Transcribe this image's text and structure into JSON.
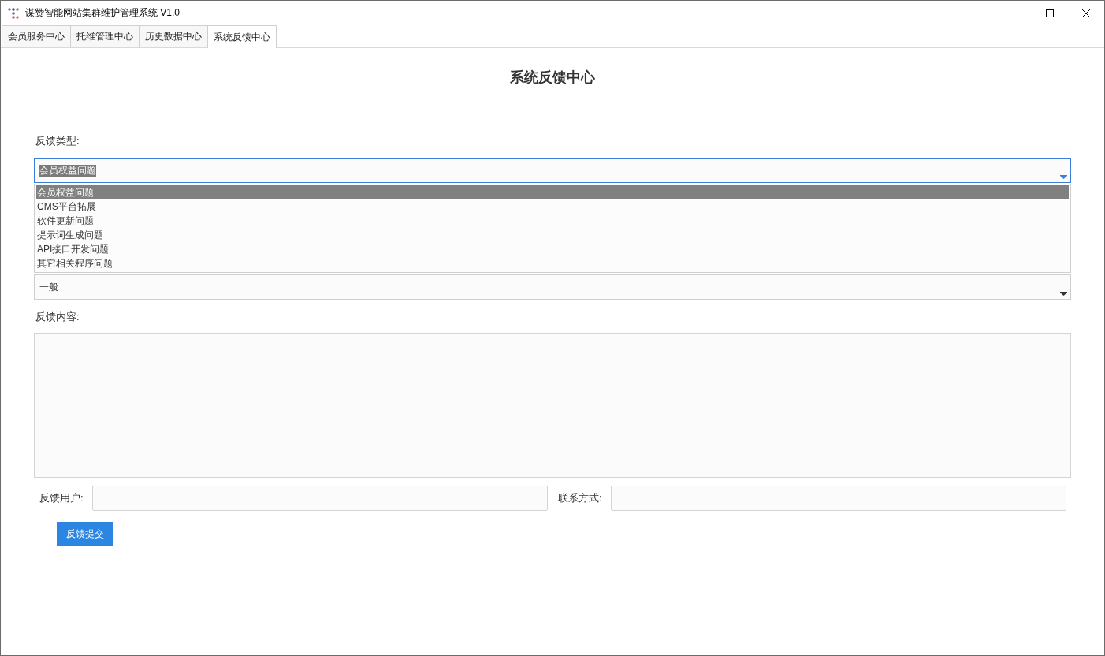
{
  "window": {
    "title": "谋赞智能网站集群维护管理系统 V1.0"
  },
  "tabs": [
    {
      "label": "会员服务中心",
      "selected": false
    },
    {
      "label": "托维管理中心",
      "selected": false
    },
    {
      "label": "历史数据中心",
      "selected": false
    },
    {
      "label": "系统反馈中心",
      "selected": true
    }
  ],
  "page_title": "系统反馈中心",
  "feedback_type": {
    "label": "反馈类型:",
    "value": "会员权益问题",
    "focused": true,
    "expanded": true,
    "options": [
      {
        "label": "会员权益问题",
        "selected": true
      },
      {
        "label": "CMS平台拓展",
        "selected": false
      },
      {
        "label": "软件更新问题",
        "selected": false
      },
      {
        "label": "提示词生成问题",
        "selected": false
      },
      {
        "label": "API接口开发问题",
        "selected": false
      },
      {
        "label": "其它相关程序问题",
        "selected": false
      }
    ]
  },
  "priority": {
    "value": "一般",
    "focused": false
  },
  "content": {
    "label": "反馈内容:"
  },
  "user": {
    "label": "反馈用户:"
  },
  "contact": {
    "label": "联系方式:"
  },
  "submit_button": "反馈提交"
}
